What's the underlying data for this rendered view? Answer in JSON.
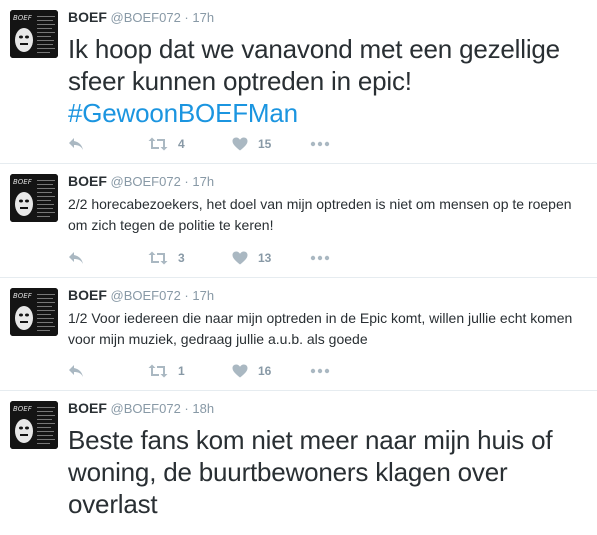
{
  "tweets": [
    {
      "name": "BOEF",
      "handle": "@BOEF072",
      "dot": "·",
      "time": "17h",
      "text": "Ik hoop dat we vanavond met een gezellige sfeer kunnen optreden in epic!",
      "hashtag": "#GewoonBOEFMan",
      "retweets": "4",
      "likes": "15"
    },
    {
      "name": "BOEF",
      "handle": "@BOEF072",
      "dot": "·",
      "time": "17h",
      "text": "2/2 horecabezoekers, het doel van mijn optreden is niet om mensen op te roepen om zich tegen de politie te keren!",
      "retweets": "3",
      "likes": "13"
    },
    {
      "name": "BOEF",
      "handle": "@BOEF072",
      "dot": "·",
      "time": "17h",
      "text": "1/2 Voor iedereen die naar mijn optreden in de Epic komt, willen jullie echt komen voor mijn muziek, gedraag jullie a.u.b. als goede",
      "retweets": "1",
      "likes": "16"
    },
    {
      "name": "BOEF",
      "handle": "@BOEF072",
      "dot": "·",
      "time": "18h",
      "text": "Beste fans kom niet meer naar mijn huis of woning, de buurtbewoners klagen over overlast"
    }
  ],
  "icons": {
    "reply": "reply-icon",
    "retweet": "retweet-icon",
    "like": "heart-icon",
    "more": "more-icon"
  },
  "colors": {
    "name": "#292f33",
    "meta": "#8899a6",
    "hashtag": "#1b95e0",
    "icon": "#aab8c2",
    "divider": "#e6ecf0"
  }
}
